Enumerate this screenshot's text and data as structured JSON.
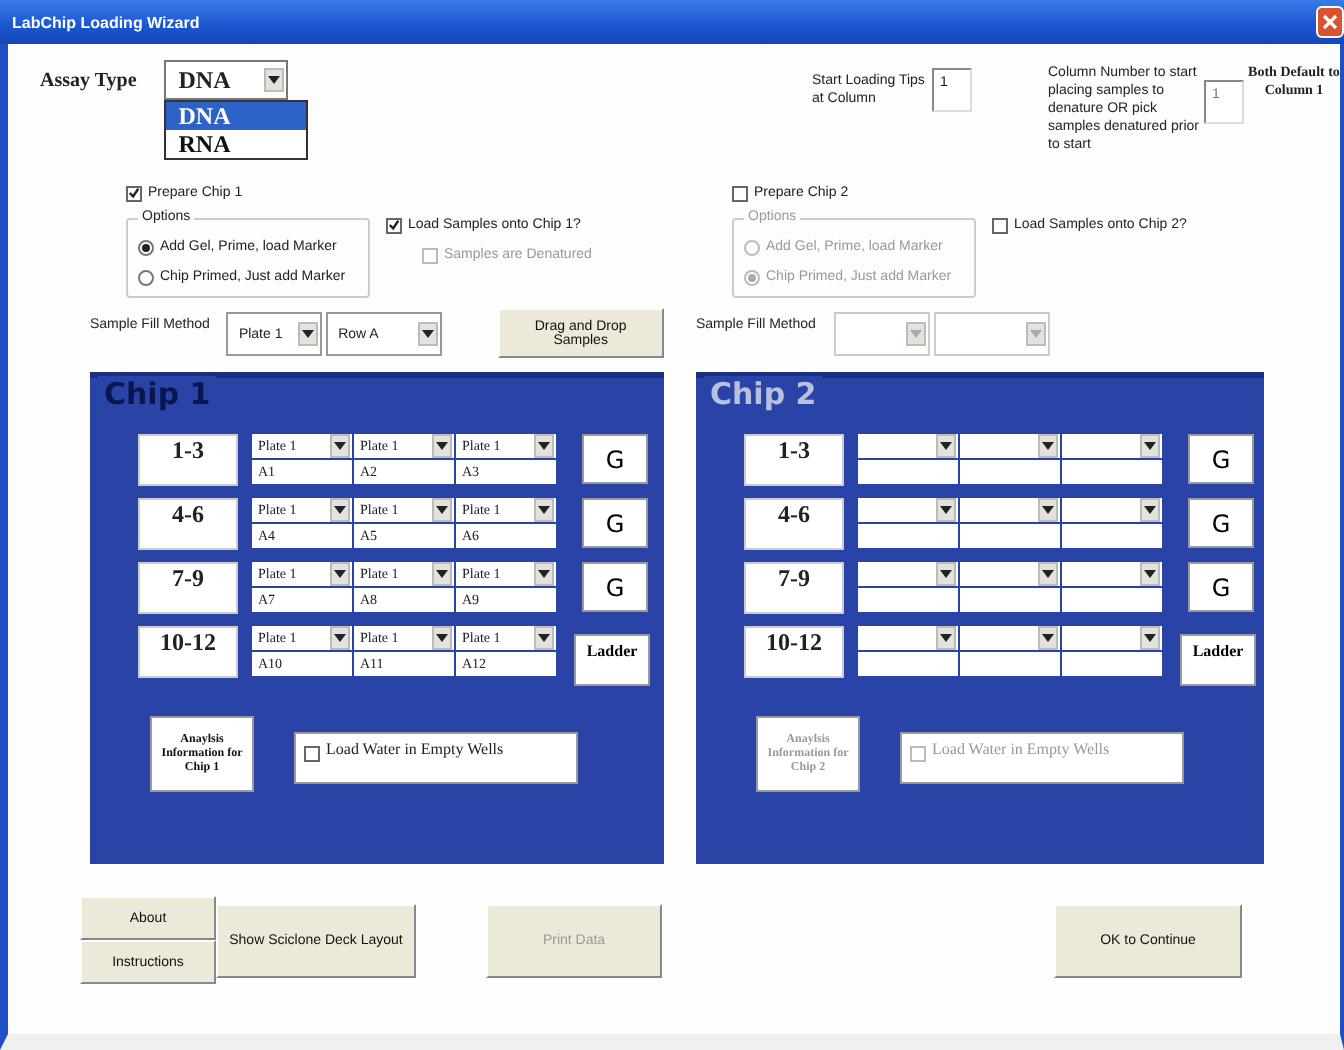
{
  "window": {
    "title": "LabChip Loading Wizard"
  },
  "assay_type": {
    "label": "Assay Type",
    "value": "DNA",
    "expanded": true,
    "options": [
      {
        "label": "DNA",
        "selected": true
      },
      {
        "label": "RNA",
        "selected": false
      }
    ]
  },
  "start_tips": {
    "label": "Start Loading Tips at Column",
    "value": "1"
  },
  "denature_column": {
    "label": "Column Number to start placing samples to denature OR pick samples denatured prior to start",
    "value": "1",
    "disabled": true
  },
  "default_note": "Both Default to Column 1",
  "chips": [
    {
      "title": "Chip 1",
      "enabled": true,
      "prepare": {
        "label": "Prepare Chip 1",
        "checked": true
      },
      "options": {
        "label": "Options",
        "disabled": false,
        "items": [
          {
            "label": "Add Gel, Prime, load Marker",
            "selected": true
          },
          {
            "label": "Chip Primed, Just add Marker",
            "selected": false
          }
        ]
      },
      "load_samples": {
        "label": "Load Samples onto Chip 1?",
        "checked": true
      },
      "denatured": {
        "label": "Samples are Denatured",
        "checked": false,
        "disabled": true
      },
      "fill_method": {
        "label": "Sample Fill Method",
        "disabled": false,
        "selects": [
          {
            "kind": "filled",
            "value": "Plate 1"
          },
          {
            "kind": "filled",
            "value": "Row A"
          }
        ]
      },
      "drag_button": {
        "label": "Drag and Drop Samples"
      },
      "rows": [
        {
          "label": "1-3",
          "button": "G",
          "wells": [
            {
              "kind": "filled",
              "plate": "Plate 1",
              "well": "A1"
            },
            {
              "kind": "filled",
              "plate": "Plate 1",
              "well": "A2"
            },
            {
              "kind": "filled",
              "plate": "Plate 1",
              "well": "A3"
            }
          ]
        },
        {
          "label": "4-6",
          "button": "G",
          "wells": [
            {
              "kind": "filled",
              "plate": "Plate 1",
              "well": "A4"
            },
            {
              "kind": "filled",
              "plate": "Plate 1",
              "well": "A5"
            },
            {
              "kind": "filled",
              "plate": "Plate 1",
              "well": "A6"
            }
          ]
        },
        {
          "label": "7-9",
          "button": "G",
          "wells": [
            {
              "kind": "filled",
              "plate": "Plate 1",
              "well": "A7"
            },
            {
              "kind": "filled",
              "plate": "Plate 1",
              "well": "A8"
            },
            {
              "kind": "filled",
              "plate": "Plate 1",
              "well": "A9"
            }
          ]
        },
        {
          "label": "10-12",
          "button": "Ladder",
          "wells": [
            {
              "kind": "filled",
              "plate": "Plate 1",
              "well": "A10"
            },
            {
              "kind": "filled",
              "plate": "Plate 1",
              "well": "A11"
            },
            {
              "kind": "filled",
              "plate": "Plate 1",
              "well": "A12"
            }
          ]
        }
      ],
      "analysis_button": {
        "label": "Anaylsis Information for Chip 1",
        "disabled": false
      },
      "load_water": {
        "label": "Load Water in Empty Wells",
        "checked": false,
        "disabled": false
      }
    },
    {
      "title": "Chip 2",
      "enabled": false,
      "prepare": {
        "label": "Prepare Chip 2",
        "checked": false
      },
      "options": {
        "label": "Options",
        "disabled": true,
        "items": [
          {
            "label": "Add Gel, Prime, load Marker",
            "selected": false
          },
          {
            "label": "Chip Primed, Just add Marker",
            "selected": true
          }
        ]
      },
      "load_samples": {
        "label": "Load Samples onto Chip 2?",
        "checked": false
      },
      "fill_method": {
        "label": "Sample Fill Method",
        "disabled": true,
        "selects": [
          {
            "kind": "blank"
          },
          {
            "kind": "blank"
          }
        ]
      },
      "rows": [
        {
          "label": "1-3",
          "button": "G",
          "wells": [
            {
              "kind": "blank"
            },
            {
              "kind": "blank"
            },
            {
              "kind": "blank"
            }
          ]
        },
        {
          "label": "4-6",
          "button": "G",
          "wells": [
            {
              "kind": "blank"
            },
            {
              "kind": "blank"
            },
            {
              "kind": "blank"
            }
          ]
        },
        {
          "label": "7-9",
          "button": "G",
          "wells": [
            {
              "kind": "blank"
            },
            {
              "kind": "blank"
            },
            {
              "kind": "blank"
            }
          ]
        },
        {
          "label": "10-12",
          "button": "Ladder",
          "wells": [
            {
              "kind": "blank"
            },
            {
              "kind": "blank"
            },
            {
              "kind": "blank"
            }
          ]
        }
      ],
      "analysis_button": {
        "label": "Anaylsis Information for Chip 2",
        "disabled": true
      },
      "load_water": {
        "label": "Load Water in Empty Wells",
        "checked": false,
        "disabled": true
      }
    }
  ],
  "footer": {
    "stacked": [
      {
        "label": "About"
      },
      {
        "label": "Instructions"
      }
    ],
    "deck_button": {
      "label": "Show Sciclone Deck Layout"
    },
    "print_button": {
      "label": "Print Data",
      "disabled": true
    },
    "continue_button": {
      "label": "OK to Continue",
      "disabled": false
    }
  }
}
